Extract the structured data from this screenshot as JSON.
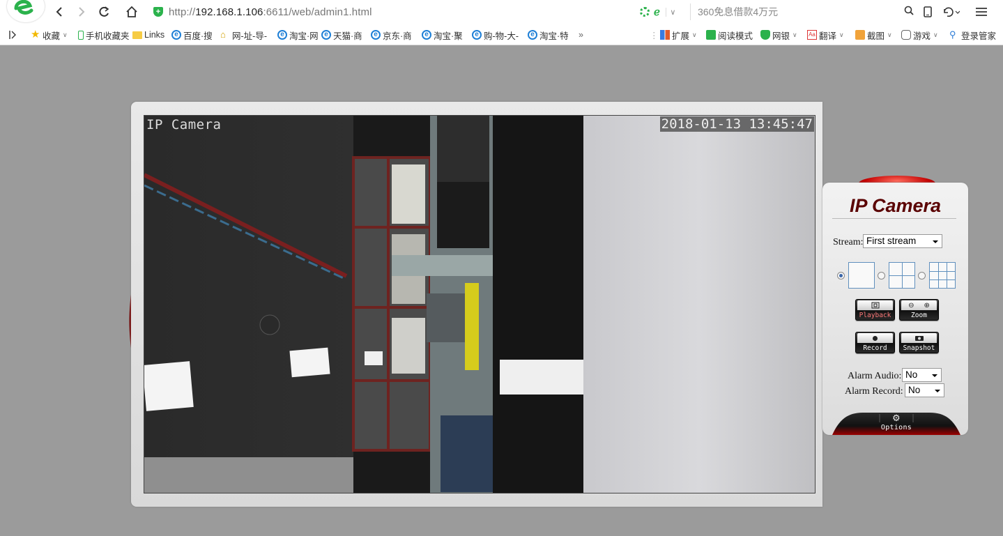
{
  "browser": {
    "url_prefix": "http://",
    "url_host": "192.168.1.106",
    "url_rest": ":6611/web/admin1.html",
    "search_placeholder": "360免息借款4万元",
    "brand_color": "#2bb24c"
  },
  "bookmarks": [
    {
      "label": "收藏",
      "icon": "star-icon",
      "caret": true
    },
    {
      "label": "手机收藏夹",
      "icon": "phone-icon"
    },
    {
      "label": "Links",
      "icon": "folder-icon"
    },
    {
      "label": "百度·搜",
      "icon": "ie-icon"
    },
    {
      "label": "网-址-导-",
      "icon": "home-icon"
    },
    {
      "label": "淘宝·网",
      "icon": "ie-icon"
    },
    {
      "label": "天猫·商",
      "icon": "ie-icon"
    },
    {
      "label": "京东·商",
      "icon": "ie-icon"
    },
    {
      "label": "淘宝·聚",
      "icon": "ie-icon"
    },
    {
      "label": "购-物-大-",
      "icon": "ie-icon"
    },
    {
      "label": "淘宝·特",
      "icon": "ie-icon"
    }
  ],
  "extensions": [
    {
      "label": "扩展",
      "icon": "grid-icon",
      "caret": true
    },
    {
      "label": "阅读模式",
      "icon": "book-icon"
    },
    {
      "label": "网银",
      "icon": "shield-icon",
      "caret": true
    },
    {
      "label": "翻译",
      "icon": "translate-icon",
      "caret": true
    },
    {
      "label": "截图",
      "icon": "scissors-icon",
      "caret": true
    },
    {
      "label": "游戏",
      "icon": "gamepad-icon",
      "caret": true
    },
    {
      "label": "登录管家",
      "icon": "key-icon"
    }
  ],
  "camera": {
    "osd_name": "IP Camera",
    "osd_time": "2018-01-13 13:45:47"
  },
  "panel": {
    "title": "IP Camera",
    "stream_label": "Stream:",
    "stream_value": "First stream",
    "layout_options": [
      "1",
      "4",
      "9"
    ],
    "layout_selected": "1",
    "buttons": {
      "playback": "Playback",
      "zoom": "Zoom",
      "record": "Record",
      "snapshot": "Snapshot"
    },
    "alarm_audio_label": "Alarm Audio:",
    "alarm_audio_value": "No",
    "alarm_record_label": "Alarm Record:",
    "alarm_record_value": "No",
    "options_label": "Options"
  }
}
